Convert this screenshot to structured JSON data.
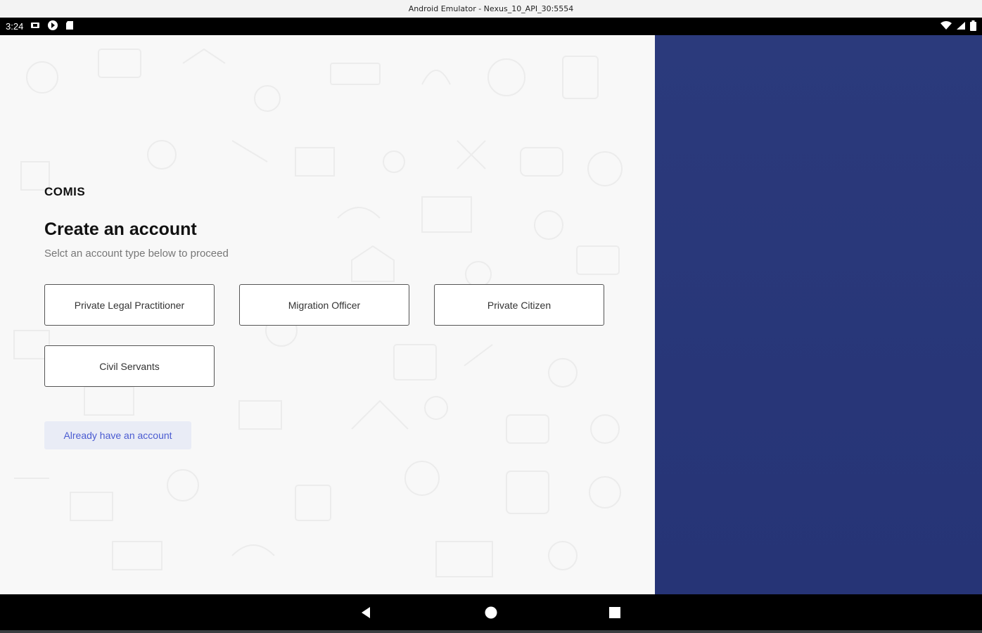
{
  "window": {
    "title": "Android Emulator - Nexus_10_API_30:5554"
  },
  "statusbar": {
    "time": "3:24",
    "icons": [
      "sim-card-icon",
      "google-play-icon",
      "sd-card-icon"
    ],
    "right_icons": [
      "wifi-icon",
      "signal-icon",
      "battery-icon"
    ]
  },
  "app": {
    "brand": "COMIS",
    "title": "Create an account",
    "subtitle": "Selct an account type below to proceed",
    "account_types": [
      {
        "label": "Private Legal Practitioner"
      },
      {
        "label": "Migration Officer"
      },
      {
        "label": "Private Citizen"
      },
      {
        "label": "Civil Servants"
      }
    ],
    "login_link": "Already have an account"
  },
  "colors": {
    "accent_panel": "#2b3a7c",
    "link": "#4a5bd1",
    "link_bg": "#e9ecf6"
  },
  "navbar": {
    "icons": [
      "back-icon",
      "home-icon",
      "recents-icon"
    ]
  }
}
